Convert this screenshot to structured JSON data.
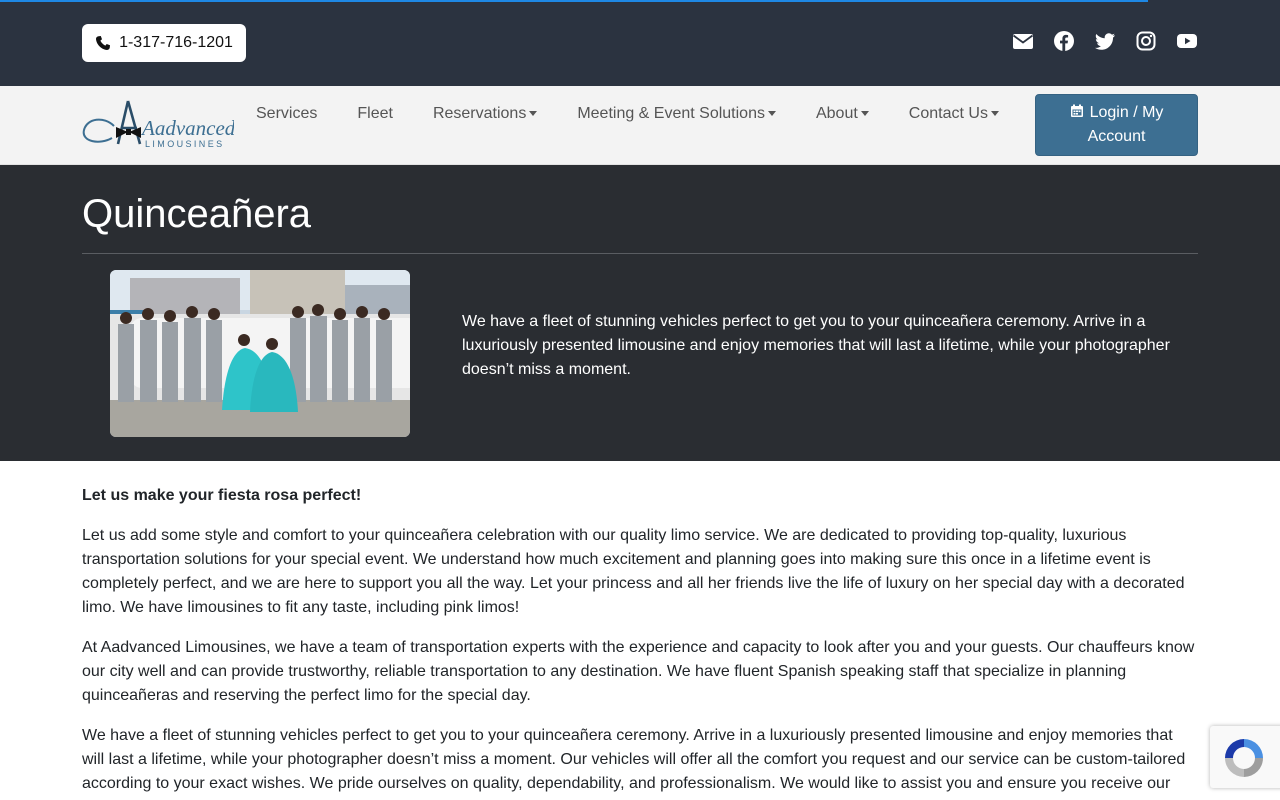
{
  "progress": {
    "value": 0.897
  },
  "topbar": {
    "phone": "1-317-716-1201",
    "social": [
      "envelope-icon",
      "facebook-icon",
      "twitter-icon",
      "instagram-icon",
      "youtube-icon"
    ]
  },
  "brand": {
    "name_main": "Aadvanced",
    "name_sub": "LIMOUSINES"
  },
  "nav": {
    "items": [
      {
        "label": "Services",
        "dropdown": false
      },
      {
        "label": "Fleet",
        "dropdown": false
      },
      {
        "label": "Reservations",
        "dropdown": true
      },
      {
        "label": "Meeting & Event Solutions",
        "dropdown": true
      },
      {
        "label": "About",
        "dropdown": true
      },
      {
        "label": "Contact Us",
        "dropdown": true
      }
    ],
    "login_line1": "Login / My",
    "login_line2": "Account"
  },
  "hero": {
    "title": "Quinceañera",
    "text": "We have a fleet of stunning vehicles perfect to get you to your quinceañera ceremony. Arrive in a luxuriously presented limousine and enjoy memories that will last a lifetime, while your photographer doesn’t miss a moment."
  },
  "content": {
    "heading": "Let us make your fiesta rosa perfect!",
    "paragraphs": [
      "Let us add some style and comfort to your quinceañera celebration with our quality limo service. We are dedicated to providing top-quality, luxurious transportation solutions for your special event. We understand how much excitement and planning goes into making sure this once in a lifetime event is completely perfect, and we are here to support you all the way. Let your princess and all her friends live the life of luxury on her special day with a decorated limo. We have limousines to fit any taste, including pink limos!",
      "At Aadvanced Limousines, we have a team of transportation experts with the experience and capacity to look after you and your guests. Our chauffeurs know our city well and can provide trustworthy, reliable transportation to any destination. We have fluent Spanish speaking staff that specialize in planning quinceañeras and reserving the perfect limo for the special day.",
      "We have a fleet of stunning vehicles perfect to get you to your quinceañera ceremony. Arrive in a luxuriously presented limousine and enjoy memories that will last a lifetime, while your photographer doesn’t miss a moment. Our vehicles will offer all the comfort you request and our service can be custom-tailored according to your exact wishes. We pride ourselves on quality, dependability, and professionalism. We would like to assist you and ensure you receive our"
    ]
  },
  "colors": {
    "topbar_bg": "#2b3340",
    "hero_bg": "#2a2d32",
    "login_bg": "#3d6f92",
    "accent_bar": "#1e88e5"
  }
}
